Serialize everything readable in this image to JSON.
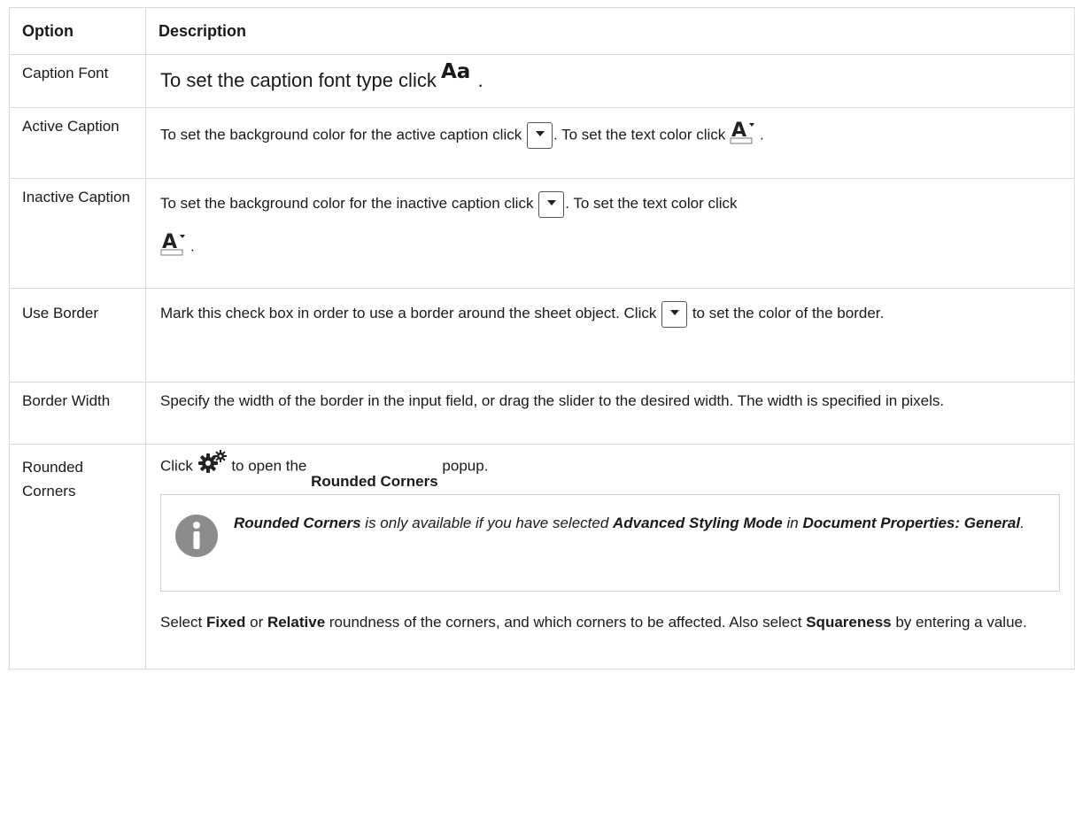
{
  "headers": {
    "option": "Option",
    "description": "Description"
  },
  "rows": [
    {
      "option": "Caption Font",
      "d1": "To set the caption font type click",
      "d2": "."
    },
    {
      "option": "Active Caption",
      "d1": "To set the background color for the active caption click",
      "d2": ". To set the text color click",
      "d3": "."
    },
    {
      "option": "Inactive Caption",
      "d1": "To set the background color for the inactive caption click",
      "d2": ". To set the text color click",
      "d3": "."
    },
    {
      "option": "Use Border",
      "d1": "Mark this check box in order to use a border around the sheet object. Click",
      "d2": "to set the color of the border."
    },
    {
      "option": "Border Width",
      "d1": "Specify the width of the border in the input field, or drag the slider to the desired width. The width is specified in pixels."
    },
    {
      "option": "Rounded Corners",
      "d1": "Click",
      "d2": "to open the",
      "popup_name": "Rounded Corners",
      "d3": "popup.",
      "note": {
        "b1": "Rounded Corners",
        "t1": " is only available if you have selected ",
        "b2": "Advanced Styling Mode",
        "t2": " in ",
        "b3": "Document Properties: General",
        "t3": "."
      },
      "p1": "Select ",
      "fixed": "Fixed",
      "p2": " or ",
      "relative": "Relative",
      "p3": " roundness of the corners, and which corners to be affected. Also select ",
      "squareness": "Squareness",
      "p4": " by entering a value."
    }
  ],
  "icons": {
    "font": "font-icon-Aa",
    "color_dropdown": "color-dropdown-icon",
    "text_color": "text-color-icon",
    "settings": "gear-icon",
    "info": "info-icon"
  }
}
